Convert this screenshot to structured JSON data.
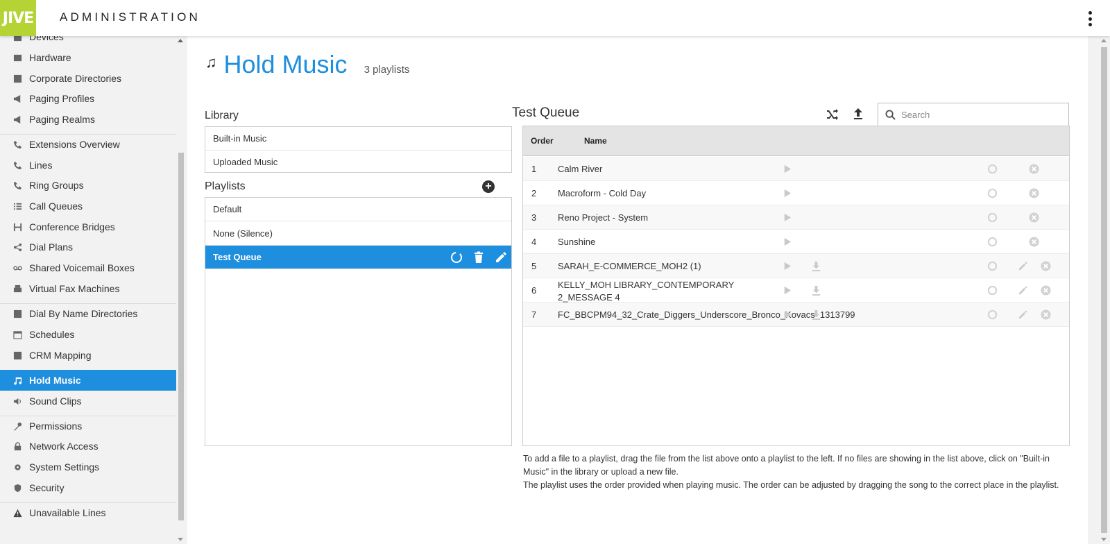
{
  "header": {
    "logo_text": "JIVE",
    "app_title": "ADMINISTRATION",
    "menu_icon": "kebab-menu-icon"
  },
  "sidebar": {
    "items": [
      {
        "label": "Devices",
        "icon": "devices-icon"
      },
      {
        "label": "Hardware",
        "icon": "hardware-icon"
      },
      {
        "label": "Corporate Directories",
        "icon": "directory-icon"
      },
      {
        "label": "Paging Profiles",
        "icon": "megaphone-icon"
      },
      {
        "label": "Paging Realms",
        "icon": "megaphone-icon"
      },
      {
        "label": "Extensions Overview",
        "icon": "phone-icon"
      },
      {
        "label": "Lines",
        "icon": "phone-icon"
      },
      {
        "label": "Ring Groups",
        "icon": "ring-group-icon"
      },
      {
        "label": "Call Queues",
        "icon": "list-icon"
      },
      {
        "label": "Conference Bridges",
        "icon": "bridge-icon"
      },
      {
        "label": "Dial Plans",
        "icon": "share-icon"
      },
      {
        "label": "Shared Voicemail Boxes",
        "icon": "voicemail-icon"
      },
      {
        "label": "Virtual Fax Machines",
        "icon": "fax-icon"
      },
      {
        "label": "Dial By Name Directories",
        "icon": "directory-icon"
      },
      {
        "label": "Schedules",
        "icon": "calendar-icon"
      },
      {
        "label": "CRM Mapping",
        "icon": "crm-icon"
      },
      {
        "label": "Hold Music",
        "icon": "music-note-icon"
      },
      {
        "label": "Sound Clips",
        "icon": "speaker-icon"
      },
      {
        "label": "Permissions",
        "icon": "key-icon"
      },
      {
        "label": "Network Access",
        "icon": "lock-icon"
      },
      {
        "label": "System Settings",
        "icon": "gear-icon"
      },
      {
        "label": "Security",
        "icon": "shield-icon"
      },
      {
        "label": "Unavailable Lines",
        "icon": "warning-icon"
      }
    ],
    "active": "Hold Music"
  },
  "page": {
    "title": "Hold Music",
    "playlist_count": "3 playlists"
  },
  "library": {
    "label": "Library",
    "items": [
      "Built-in Music",
      "Uploaded Music"
    ]
  },
  "playlists": {
    "label": "Playlists",
    "items": [
      "Default",
      "None (Silence)",
      "Test Queue"
    ],
    "selected": "Test Queue"
  },
  "queue": {
    "title": "Test Queue",
    "search_placeholder": "Search",
    "columns": {
      "order": "Order",
      "name": "Name"
    },
    "rows": [
      {
        "order": "1",
        "name": "Calm River"
      },
      {
        "order": "2",
        "name": "Macroform - Cold Day"
      },
      {
        "order": "3",
        "name": "Reno Project - System"
      },
      {
        "order": "4",
        "name": "Sunshine"
      },
      {
        "order": "5",
        "name": "SARAH_E-COMMERCE_MOH2 (1)"
      },
      {
        "order": "6",
        "name": "KELLY_MOH LIBRARY_CONTEMPORARY 2_MESSAGE 4"
      },
      {
        "order": "7",
        "name": "FC_BBCPM94_32_Crate_Diggers_Underscore_Bronco_Kovacs_1313799"
      }
    ]
  },
  "help": {
    "line1": "To add a file to a playlist, drag the file from the list above onto a playlist to the left. If no files are showing in the list above, click on \"Built-in Music\" in the library or upload a new file.",
    "line2": "The playlist uses the order provided when playing music. The order can be adjusted by dragging the song to the correct place in the playlist."
  },
  "colors": {
    "accent": "#1e8ede",
    "logo": "#b5d334"
  }
}
